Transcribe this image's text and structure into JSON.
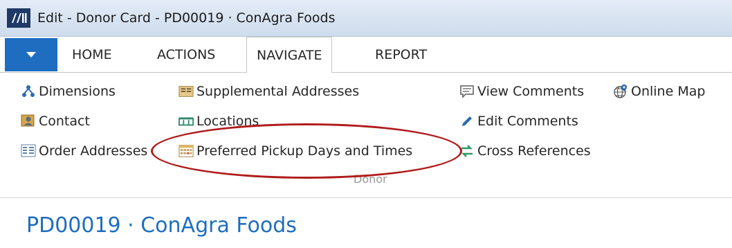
{
  "window": {
    "title": "Edit - Donor Card - PD00019 · ConAgra Foods"
  },
  "tabs": [
    {
      "label": "HOME"
    },
    {
      "label": "ACTIONS"
    },
    {
      "label": "NAVIGATE"
    },
    {
      "label": "REPORT"
    }
  ],
  "ribbon": {
    "commands": {
      "dimensions": "Dimensions",
      "contact": "Contact",
      "order_addresses": "Order Addresses",
      "supplemental_addresses": "Supplemental Addresses",
      "locations": "Locations",
      "preferred_pickup": "Preferred Pickup Days and Times",
      "view_comments": "View Comments",
      "edit_comments": "Edit Comments",
      "cross_references": "Cross References",
      "online_map": "Online Map"
    },
    "group_label": "Donor"
  },
  "page": {
    "title": "PD00019 · ConAgra Foods"
  }
}
